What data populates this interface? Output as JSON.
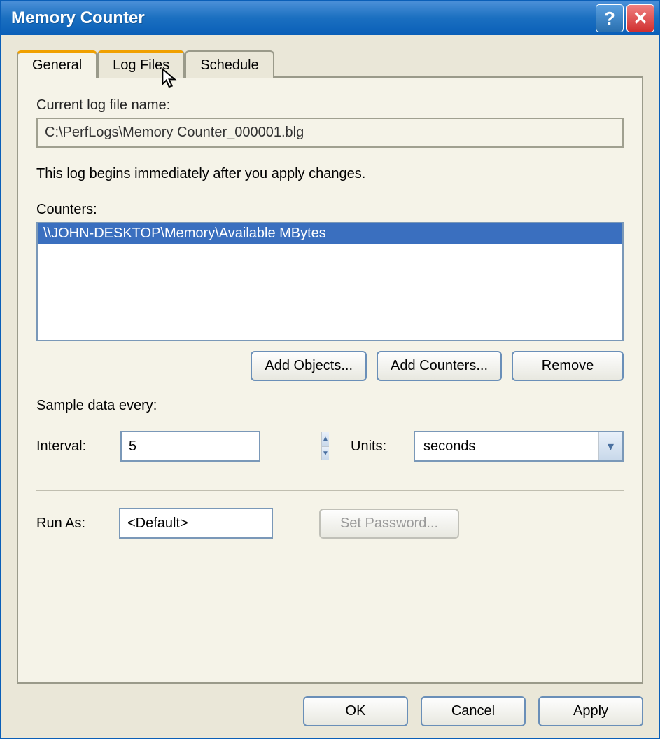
{
  "window": {
    "title": "Memory Counter"
  },
  "tabs": [
    {
      "label": "General"
    },
    {
      "label": "Log Files"
    },
    {
      "label": "Schedule"
    }
  ],
  "general": {
    "current_log_label": "Current log file name:",
    "current_log_value": "C:\\PerfLogs\\Memory Counter_000001.blg",
    "info_text": "This log begins immediately after you apply changes.",
    "counters_label": "Counters:",
    "counters": [
      "\\\\JOHN-DESKTOP\\Memory\\Available MBytes"
    ],
    "add_objects_label": "Add Objects...",
    "add_counters_label": "Add Counters...",
    "remove_label": "Remove",
    "sample_label": "Sample data every:",
    "interval_label": "Interval:",
    "interval_value": "5",
    "units_label": "Units:",
    "units_value": "seconds",
    "runas_label": "Run As:",
    "runas_value": "<Default>",
    "set_password_label": "Set Password..."
  },
  "buttons": {
    "ok": "OK",
    "cancel": "Cancel",
    "apply": "Apply"
  }
}
